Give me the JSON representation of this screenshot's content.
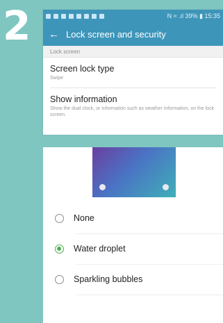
{
  "step_number": "2",
  "status_bar": {
    "right_text": "N ≈ .ıl 39% ▮ 15:35"
  },
  "header": {
    "back_icon": "arrow-left-icon",
    "title": "Lock screen and security"
  },
  "section": {
    "title": "Lock screen"
  },
  "settings": [
    {
      "title": "Screen lock type",
      "subtitle": "Swipe"
    },
    {
      "title": "Show information",
      "subtitle": "Show the dual clock, or information such as weather information, on the lock screen."
    }
  ],
  "options": [
    {
      "label": "None",
      "selected": false
    },
    {
      "label": "Water droplet",
      "selected": true
    },
    {
      "label": "Sparkling bubbles",
      "selected": false
    }
  ],
  "colors": {
    "accent": "#3e95ba",
    "background": "#7fc6c1",
    "radio_selected": "#4caf50"
  }
}
